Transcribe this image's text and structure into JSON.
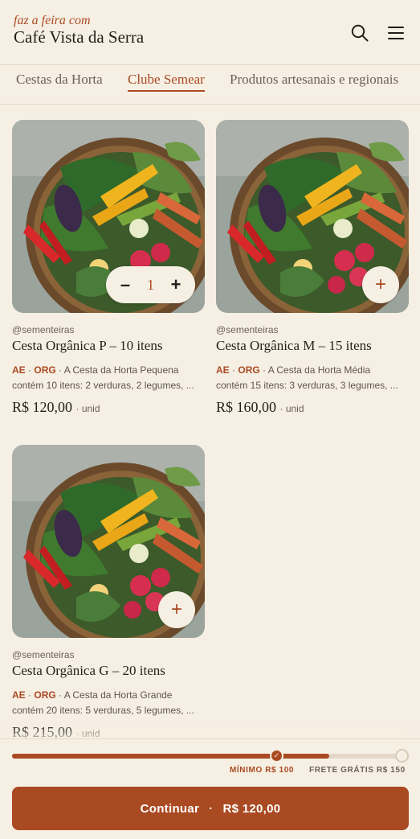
{
  "header": {
    "tagline": "faz a feira com",
    "store_name": "Café Vista da Serra",
    "search_icon": "search-icon",
    "menu_icon": "menu-icon"
  },
  "tabs": [
    {
      "label": "Cestas da Horta",
      "active": false
    },
    {
      "label": "Clube Semear",
      "active": true
    },
    {
      "label": "Produtos artesanais e regionais",
      "active": false
    }
  ],
  "products": [
    {
      "seller": "@sementeiras",
      "name": "Cesta Orgânica P – 10 itens",
      "badge1": "AE",
      "badge2": "ORG",
      "desc_line1": "A Cesta da Horta Pequena",
      "desc_line2": "contém 10 itens: 2 verduras, 2 legumes, ...",
      "price": "R$ 120,00",
      "unit": "unid",
      "quantity": "1",
      "minus": "–",
      "plus": "+"
    },
    {
      "seller": "@sementeiras",
      "name": "Cesta Orgânica M – 15 itens",
      "badge1": "AE",
      "badge2": "ORG",
      "desc_line1": "A Cesta da Horta Média",
      "desc_line2": "contém 15 itens: 3 verduras, 3 legumes, ...",
      "price": "R$ 160,00",
      "unit": "unid",
      "plus": "+"
    },
    {
      "seller": "@sementeiras",
      "name": "Cesta Orgânica G – 20 itens",
      "badge1": "AE",
      "badge2": "ORG",
      "desc_line1": "A Cesta da Horta Grande",
      "desc_line2": "contém 20 itens: 5 verduras, 5 legumes, ...",
      "price": "R$ 215,00",
      "unit": "unid",
      "plus": "+"
    }
  ],
  "footer": {
    "progress_value": 120,
    "minimum_value": 100,
    "free_shipping_value": 150,
    "minimum_label": "MÍNIMO R$ 100",
    "free_shipping_label": "FRETE GRÁTIS R$ 150",
    "check_icon": "check-icon",
    "cta_label": "Continuar",
    "cta_separator": "·",
    "cta_total": "R$ 120,00"
  },
  "colors": {
    "accent": "#a94a22",
    "background": "#f6efe3",
    "text": "#231f1b"
  }
}
